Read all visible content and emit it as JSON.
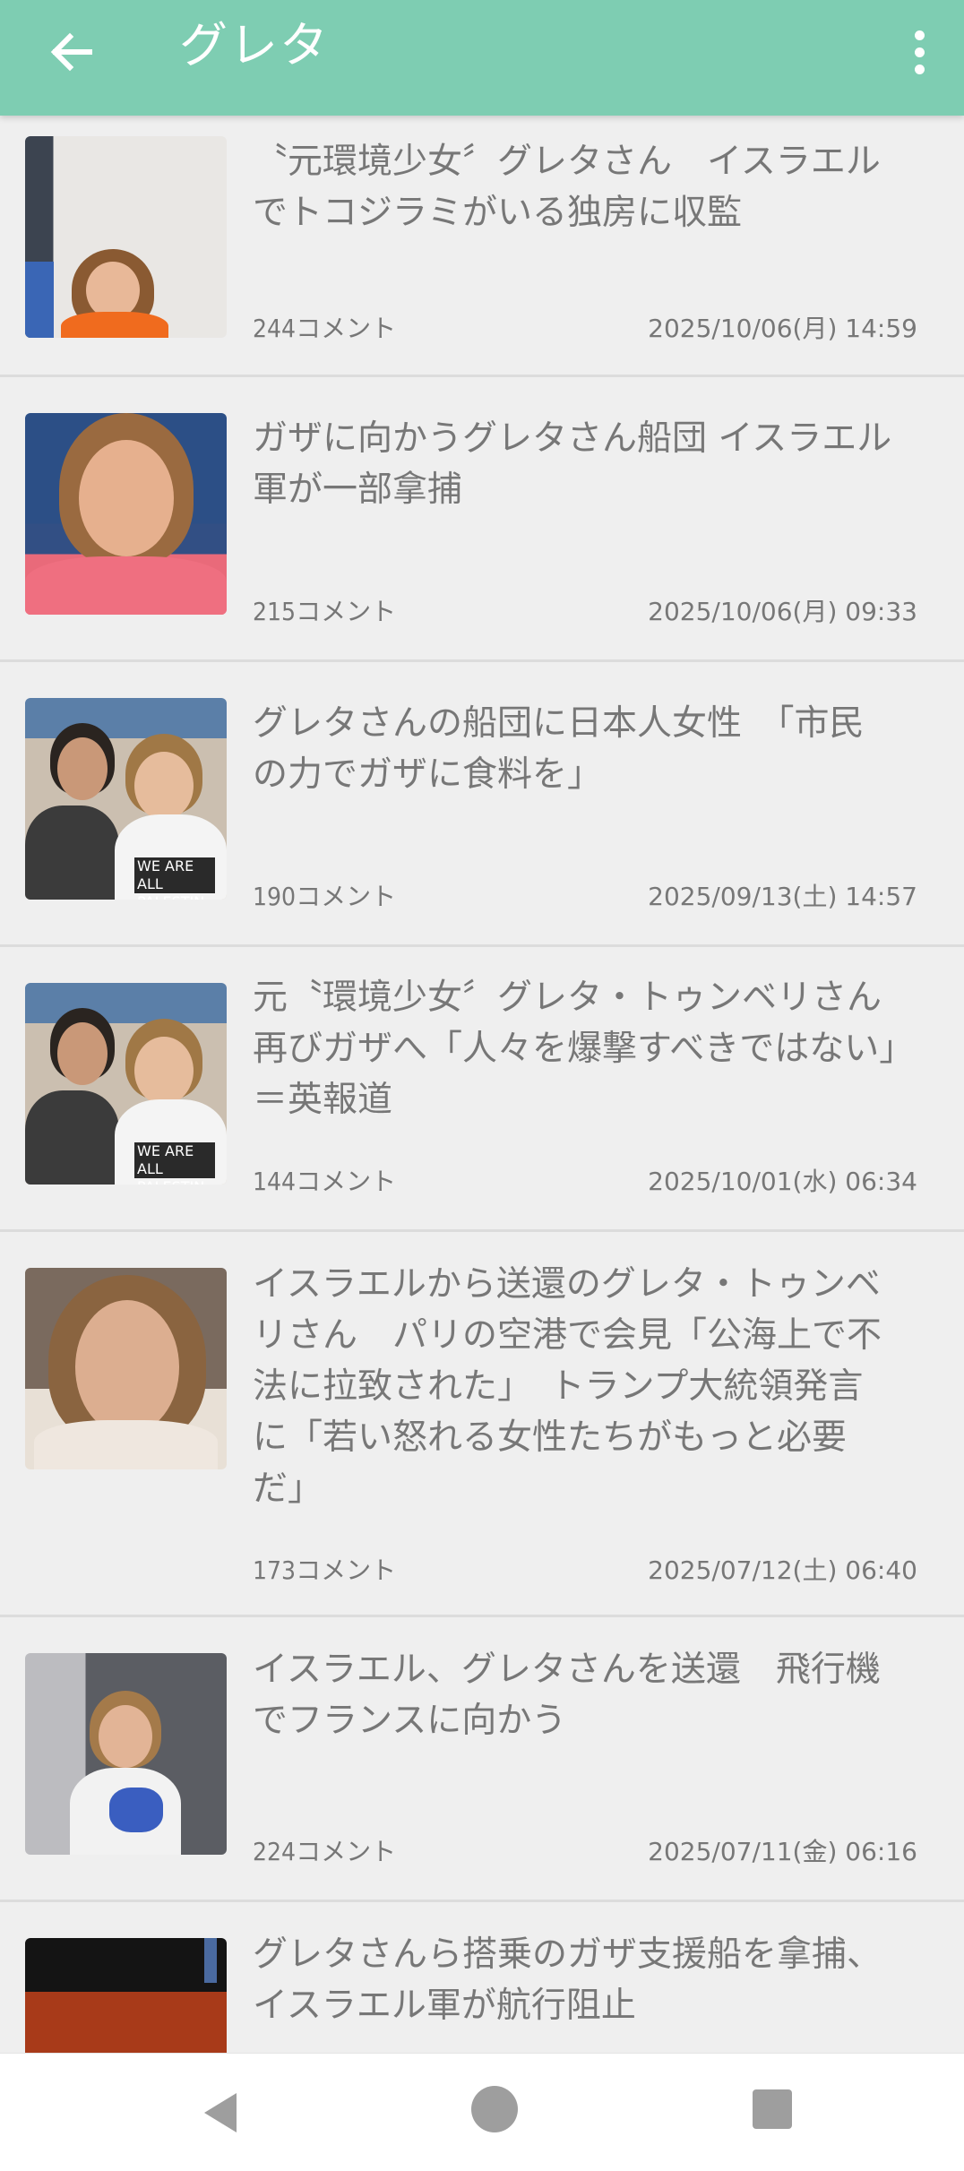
{
  "header": {
    "title": "グレタ",
    "background_color": "#7ecdb2",
    "back_icon": "arrow-left-icon",
    "menu_icon": "more-vertical-icon"
  },
  "articles": [
    {
      "title": "〝元環境少女〞グレタさん　イスラエルでトコジラミがいる独房に収監",
      "comments": "244コメント",
      "date": "2025/10/06(月)  14:59"
    },
    {
      "title": "ガザに向かうグレタさん船団 イスラエル軍が一部拿捕",
      "comments": "215コメント",
      "date": "2025/10/06(月)  09:33"
    },
    {
      "title": "グレタさんの船団に日本人女性　「市民の力でガザに食料を」",
      "comments": "190コメント",
      "date": "2025/09/13(土)  14:57"
    },
    {
      "title": "元〝環境少女〞グレタ・トゥンベリさん再びガザへ「人々を爆撃すべきではない」＝英報道",
      "comments": "144コメント",
      "date": "2025/10/01(水)  06:34"
    },
    {
      "title": "イスラエルから送還のグレタ・トゥンベリさん　パリの空港で会見「公海上で不法に拉致された」　トランプ大統領発言に「若い怒れる女性たちがもっと必要だ」",
      "comments": "173コメント",
      "date": "2025/07/12(土)  06:40"
    },
    {
      "title": "イスラエル、グレタさんを送還　飛行機でフランスに向かう",
      "comments": "224コメント",
      "date": "2025/07/11(金)  06:16"
    },
    {
      "title": "グレタさんら搭乗のガザ支援船を拿捕、イスラエル軍が航行阻止",
      "comments": "",
      "date": ""
    }
  ],
  "navbar": {
    "back_icon": "triangle-back-icon",
    "home_icon": "circle-home-icon",
    "recents_icon": "square-recents-icon"
  }
}
